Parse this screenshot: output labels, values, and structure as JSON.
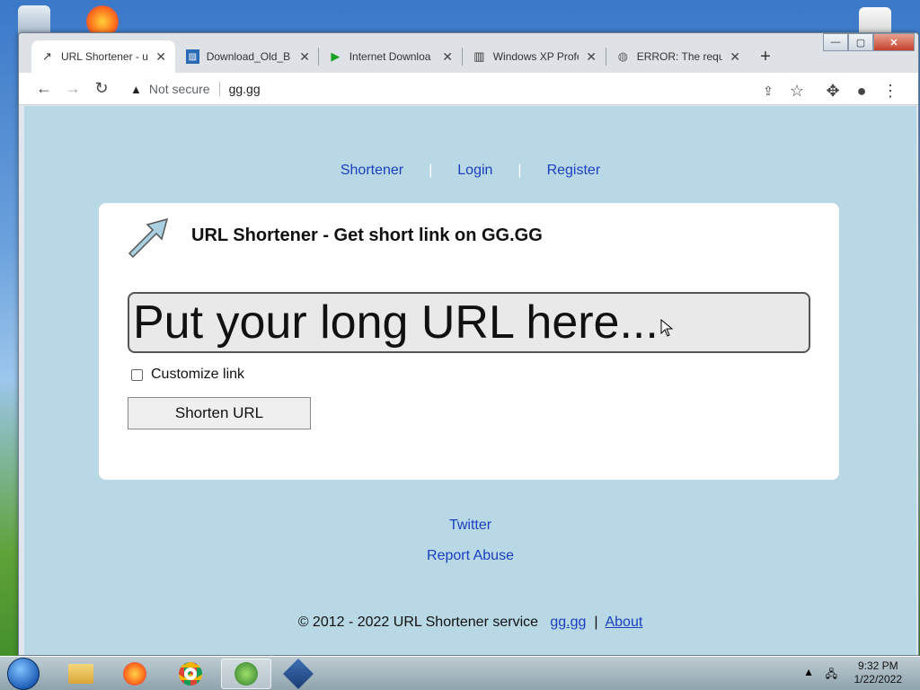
{
  "browser": {
    "tabs": [
      {
        "title": "URL Shortener - u",
        "icon": "link-icon",
        "active": true
      },
      {
        "title": "Download_Old_B",
        "icon": "image-icon",
        "active": false
      },
      {
        "title": "Internet Downloa",
        "icon": "play-icon",
        "active": false
      },
      {
        "title": "Windows XP Profe",
        "icon": "archive-icon",
        "active": false
      },
      {
        "title": "ERROR: The reque",
        "icon": "globe-icon",
        "active": false
      }
    ],
    "new_tab": "+",
    "window_controls": {
      "minimize": "—",
      "maximize": "▢",
      "close": "✕"
    },
    "address_bar": {
      "security_label": "Not secure",
      "url": "gg.gg"
    }
  },
  "page": {
    "nav": {
      "shortener": "Shortener",
      "login": "Login",
      "register": "Register",
      "separator": "|"
    },
    "card": {
      "title": "URL Shortener - Get short link on GG.GG",
      "input_placeholder": "Put your long URL here...",
      "customize_label": "Customize link",
      "customize_checked": false,
      "button_label": "Shorten URL"
    },
    "links": {
      "twitter": "Twitter",
      "report": "Report Abuse"
    },
    "footer": {
      "copyright": "© 2012 - 2022 URL Shortener service",
      "site_link": "gg.gg",
      "separator": "|",
      "about": "About"
    }
  },
  "taskbar": {
    "apps": [
      "file-explorer-icon",
      "firefox-icon",
      "chrome-icon",
      "internet-download-manager-icon",
      "virtualbox-icon"
    ],
    "active_app": "chrome-icon",
    "clock_time": "9:32 PM",
    "clock_date": "1/22/2022"
  },
  "colors": {
    "page_background": "#b9d8e6",
    "link": "#1a3fbf",
    "card": "#ffffff"
  }
}
